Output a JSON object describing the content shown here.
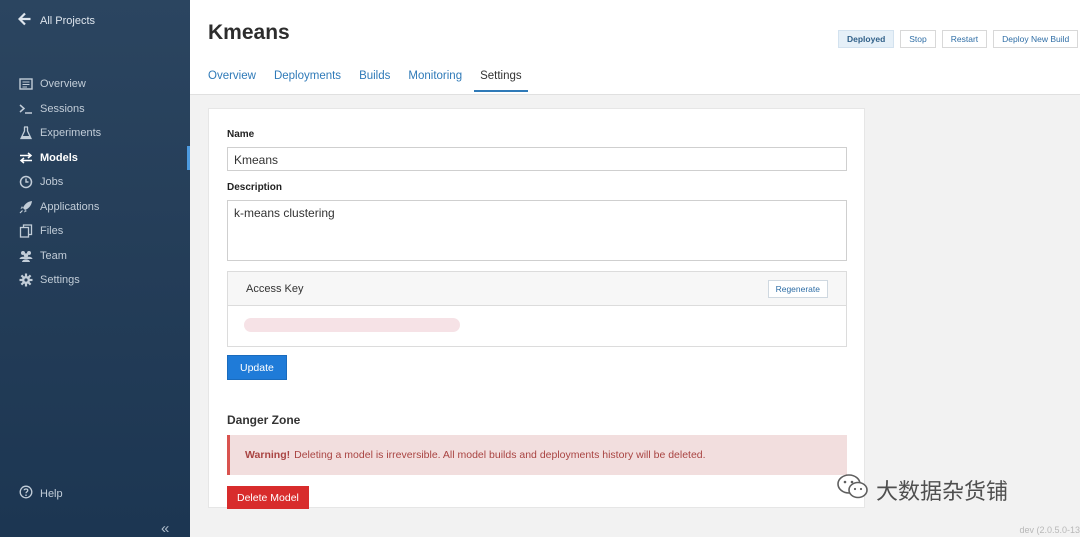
{
  "sidebar": {
    "back_label": "All Projects",
    "items": [
      {
        "label": "Overview",
        "icon": "overview-icon"
      },
      {
        "label": "Sessions",
        "icon": "terminal-icon"
      },
      {
        "label": "Experiments",
        "icon": "flask-icon"
      },
      {
        "label": "Models",
        "icon": "arrows-icon",
        "active": true
      },
      {
        "label": "Jobs",
        "icon": "clock-icon"
      },
      {
        "label": "Applications",
        "icon": "rocket-icon"
      },
      {
        "label": "Files",
        "icon": "files-icon"
      },
      {
        "label": "Team",
        "icon": "team-icon"
      },
      {
        "label": "Settings",
        "icon": "gear-icon"
      }
    ],
    "help_label": "Help",
    "collapse_glyph": "«"
  },
  "header": {
    "title": "Kmeans",
    "status": "Deployed",
    "stop": "Stop",
    "restart": "Restart",
    "deploy_new_build": "Deploy New Build",
    "tabs": [
      "Overview",
      "Deployments",
      "Builds",
      "Monitoring",
      "Settings"
    ],
    "active_tab": "Settings"
  },
  "form": {
    "name_label": "Name",
    "name_value": "Kmeans",
    "description_label": "Description",
    "description_value": "k-means clustering",
    "access_key_label": "Access Key",
    "regenerate": "Regenerate",
    "update": "Update"
  },
  "danger": {
    "title": "Danger Zone",
    "warning_bold": "Warning!",
    "warning_text": "Deleting a model is irreversible. All model builds and deployments history will be deleted.",
    "delete": "Delete Model"
  },
  "footer": {
    "version": "dev (2.0.5.0-13"
  },
  "watermark": {
    "text": "大数据杂货铺"
  },
  "colors": {
    "sidebar": "#243d58",
    "accent": "#2f7ab8",
    "primary": "#1f7bd8",
    "danger": "#d82c2c",
    "warning_bg": "#f2dede"
  }
}
